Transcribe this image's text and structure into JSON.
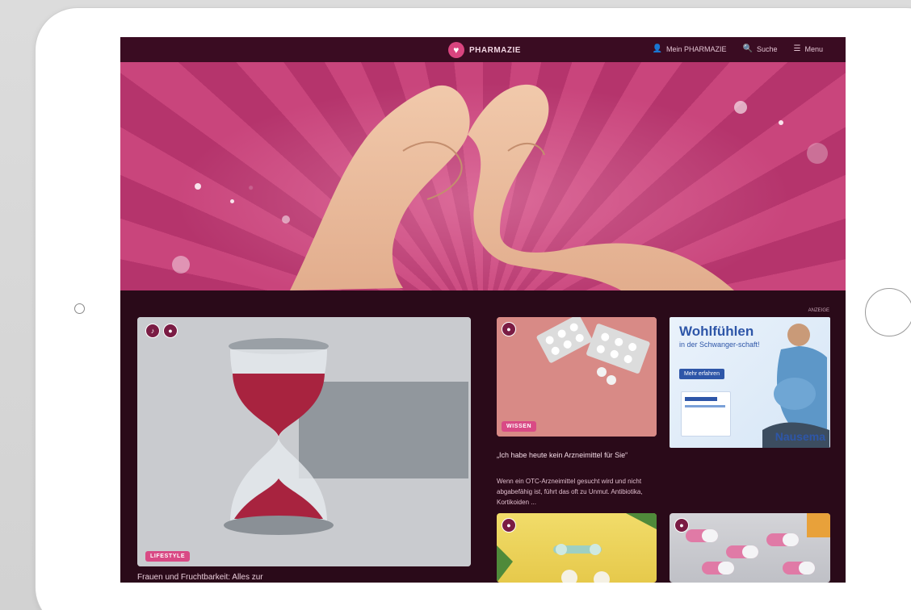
{
  "site": {
    "logo_text": "PHARMAZIE",
    "nav": [
      {
        "label": "Mein PHARMAZIE",
        "icon": "user-icon"
      },
      {
        "label": "Suche",
        "icon": "search-icon"
      },
      {
        "label": "Menu",
        "icon": "menu-icon"
      }
    ]
  },
  "main_card": {
    "tag": "LIFESTYLE",
    "title_peek": "Frauen und Fruchtbarkeit: Alles zur"
  },
  "pills_card": {
    "tag": "WISSEN",
    "title": "„Ich habe heute kein Arzneimittel für Sie“",
    "description": "Wenn ein OTC-Arzneimittel gesucht wird und nicht abgabefähig ist, führt das oft zu Unmut. Antibiotika, Kortikoiden ..."
  },
  "ad": {
    "label": "ANZEIGE",
    "headline": "Wohlfühlen",
    "subline": "in der Schwanger-schaft!",
    "button": "Mehr erfahren",
    "brand": "Nausema"
  },
  "colors": {
    "accent": "#d94a85",
    "background": "#2a0a19"
  }
}
